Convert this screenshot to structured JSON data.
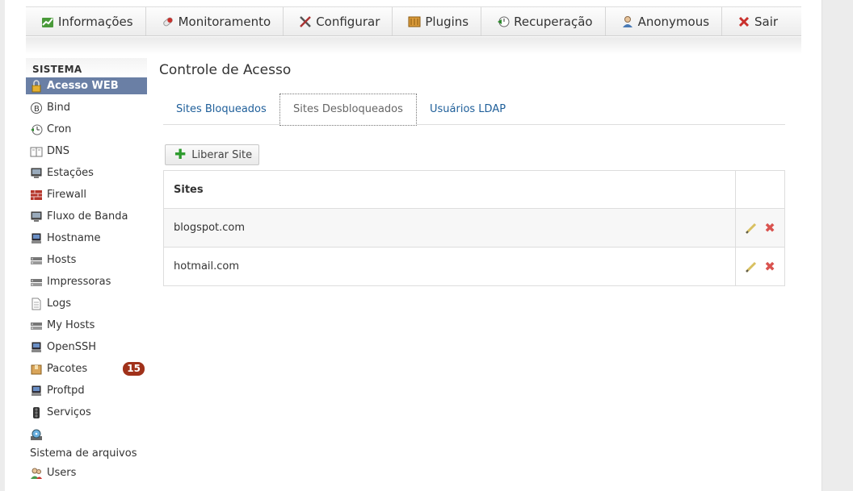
{
  "nav": {
    "items": [
      {
        "label": "Informações",
        "icon": "chart-icon"
      },
      {
        "label": "Monitoramento",
        "icon": "pill-icon"
      },
      {
        "label": "Configurar",
        "icon": "tools-icon"
      },
      {
        "label": "Plugins",
        "icon": "plugins-icon"
      },
      {
        "label": "Recuperação",
        "icon": "restore-icon"
      },
      {
        "label": "Anonymous",
        "icon": "user-icon"
      },
      {
        "label": "Sair",
        "icon": "close-icon"
      }
    ]
  },
  "sidebar": {
    "heading": "SISTEMA",
    "items": [
      {
        "label": "Acesso WEB",
        "icon": "lock-icon",
        "active": true
      },
      {
        "label": "Bind",
        "icon": "bind-icon"
      },
      {
        "label": "Cron",
        "icon": "clock-icon"
      },
      {
        "label": "DNS",
        "icon": "book-icon"
      },
      {
        "label": "Estações",
        "icon": "monitor-icon"
      },
      {
        "label": "Firewall",
        "icon": "firewall-icon"
      },
      {
        "label": "Fluxo de Banda",
        "icon": "monitor-icon"
      },
      {
        "label": "Hostname",
        "icon": "computer-icon"
      },
      {
        "label": "Hosts",
        "icon": "network-icon"
      },
      {
        "label": "Impressoras",
        "icon": "printer-icon"
      },
      {
        "label": "Logs",
        "icon": "document-icon"
      },
      {
        "label": "My Hosts",
        "icon": "network-icon"
      },
      {
        "label": "OpenSSH",
        "icon": "computer-icon"
      },
      {
        "label": "Pacotes",
        "icon": "package-icon",
        "badge": "15"
      },
      {
        "label": "Proftpd",
        "icon": "computer-icon"
      },
      {
        "label": "Serviços",
        "icon": "traffic-light-icon"
      },
      {
        "label": "Sistema de arquivos",
        "icon": "disk-icon"
      },
      {
        "label": "Users",
        "icon": "users-icon"
      }
    ]
  },
  "main": {
    "title": "Controle de Acesso",
    "tabs": [
      {
        "label": "Sites Bloqueados"
      },
      {
        "label": "Sites Desbloqueados",
        "active": true
      },
      {
        "label": "Usuários LDAP"
      }
    ],
    "add_button": "Liberar Site",
    "table": {
      "header": "Sites",
      "rows": [
        "blogspot.com",
        "hotmail.com"
      ]
    }
  },
  "colors": {
    "active_sidebar": "#6a7fa5",
    "link": "#1f5f9a",
    "badge": "#a0311a",
    "delete": "#d9534f",
    "add": "#2c9a2c"
  }
}
